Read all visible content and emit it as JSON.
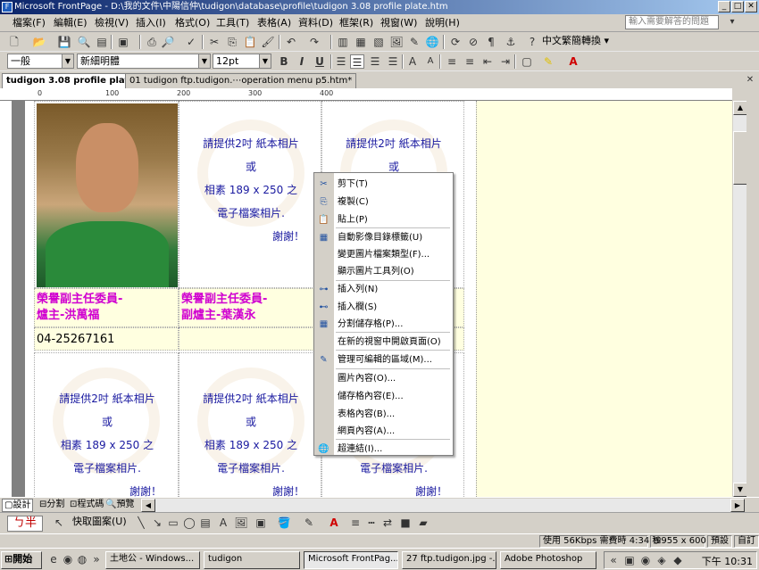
{
  "window": {
    "title": "Microsoft FrontPage - D:\\我的文件\\中陽信仲\\tudigon\\database\\profile\\tudigon 3.08 profile plate.htm"
  },
  "menu": [
    "檔案(F)",
    "編輯(E)",
    "檢視(V)",
    "插入(I)",
    "格式(O)",
    "工具(T)",
    "表格(A)",
    "資料(D)",
    "框架(R)",
    "視窗(W)",
    "說明(H)"
  ],
  "help_placeholder": "輸入需要解答的問題",
  "toolbar1": {
    "translate_label": "中文繁簡轉換"
  },
  "toolbar2": {
    "style": "一般",
    "font": "新細明體",
    "size": "12pt",
    "bold": "B",
    "italic": "I",
    "underline": "U"
  },
  "tabs": [
    "tudigon 3.08 profile plate.htm",
    "01 tudigon ftp.tudigon.⋯operation menu p5.htm*"
  ],
  "ruler_marks": [
    "0",
    "100",
    "200",
    "300",
    "400"
  ],
  "document": {
    "placeholder_lines": [
      "請提供2吋 紙本相片",
      "或",
      "相素 189 x 250 之",
      "電子檔案相片.",
      "謝謝！"
    ],
    "person1_line1": "榮譽副主任委員-",
    "person1_line2": "爐主-洪萬福",
    "person2_line1": "榮譽副主任委員-",
    "person2_line2": "副爐主-葉漢永",
    "phone": "04-25267161"
  },
  "context_menu": [
    {
      "label": "剪下(T)",
      "icon": "cut-icon",
      "glyph": "✂"
    },
    {
      "label": "複製(C)",
      "icon": "copy-icon",
      "glyph": "⎘"
    },
    {
      "label": "貼上(P)",
      "icon": "paste-icon",
      "glyph": "📋"
    },
    {
      "label": "自動影像目錄標籤(U)",
      "icon": "thumbnail-icon",
      "glyph": "▦"
    },
    {
      "label": "變更圖片檔案類型(F)...",
      "icon": "",
      "glyph": ""
    },
    {
      "label": "顯示圖片工具列(O)",
      "icon": "",
      "glyph": ""
    },
    {
      "label": "插入列(N)",
      "icon": "insert-row-icon",
      "glyph": "⊶"
    },
    {
      "label": "插入欄(S)",
      "icon": "insert-column-icon",
      "glyph": "⊷"
    },
    {
      "label": "分割儲存格(P)...",
      "icon": "split-cells-icon",
      "glyph": "▦"
    },
    {
      "label": "在新的視窗中開啟頁面(O)",
      "icon": "",
      "glyph": ""
    },
    {
      "label": "管理可編輯的區域(M)...",
      "icon": "editable-region-icon",
      "glyph": "✎"
    },
    {
      "label": "圖片內容(O)...",
      "icon": "",
      "glyph": ""
    },
    {
      "label": "儲存格內容(E)...",
      "icon": "",
      "glyph": ""
    },
    {
      "label": "表格內容(B)...",
      "icon": "",
      "glyph": ""
    },
    {
      "label": "網頁內容(A)...",
      "icon": "",
      "glyph": ""
    },
    {
      "label": "超連結(I)...",
      "icon": "hyperlink-icon",
      "glyph": "🌐"
    }
  ],
  "view_buttons": [
    "設計",
    "分割",
    "程式碼",
    "預覽"
  ],
  "drawbar": {
    "ime": "ㄅ半",
    "autoshapes": "快取圖案(U)"
  },
  "status": {
    "speed": "使用 56Kbps 需費時 4:34 秒",
    "size": "955 x 600",
    "mode1": "預設",
    "mode2": "自訂"
  },
  "taskbar": {
    "start": "開始",
    "tasks": [
      "土地公 - Windows...",
      "tudigon",
      "Microsoft FrontPag...",
      "27 ftp.tudigon.jpg -...",
      "Adobe Photoshop"
    ],
    "clock": "下午 10:31"
  }
}
